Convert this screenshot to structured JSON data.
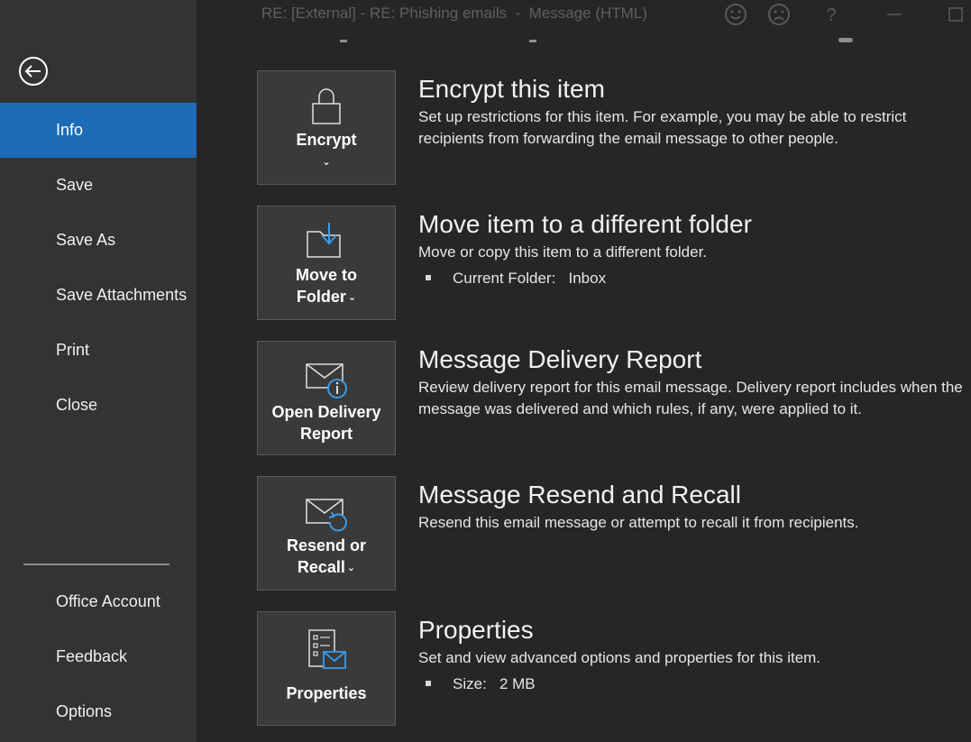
{
  "titlebar": {
    "title": "RE: [External] - RE: Phishing emails  -  Message (HTML)"
  },
  "sidebar": {
    "items": [
      {
        "label": "Info",
        "active": true
      },
      {
        "label": "Save"
      },
      {
        "label": "Save As"
      },
      {
        "label": "Save Attachments"
      },
      {
        "label": "Print"
      },
      {
        "label": "Close"
      }
    ],
    "bottom_items": [
      {
        "label": "Office Account"
      },
      {
        "label": "Feedback"
      },
      {
        "label": "Options"
      }
    ]
  },
  "actions": [
    {
      "button_label": "Encrypt",
      "title": "Encrypt this item",
      "description": "Set up restrictions for this item. For example, you may be able to restrict recipients from forwarding the email message to other people."
    },
    {
      "button_label_line1": "Move to",
      "button_label_line2": "Folder",
      "title": "Move item to a different folder",
      "description": "Move or copy this item to a different folder.",
      "bullet_label": "Current Folder:",
      "bullet_value": "Inbox"
    },
    {
      "button_label_line1": "Open Delivery",
      "button_label_line2": "Report",
      "title": "Message Delivery Report",
      "description": "Review delivery report for this email message. Delivery report includes when the message was delivered and which rules, if any, were applied to it."
    },
    {
      "button_label_line1": "Resend or",
      "button_label_line2": "Recall",
      "title": "Message Resend and Recall",
      "description": "Resend this email message or attempt to recall it from recipients."
    },
    {
      "button_label": "Properties",
      "title": "Properties",
      "description": "Set and view advanced options and properties for this item.",
      "bullet_label": "Size:",
      "bullet_value": "2 MB"
    }
  ],
  "colors": {
    "sidebar_bg": "#333333",
    "main_bg": "#262626",
    "accent": "#1e6bb8",
    "icon_blue": "#3a9be8"
  },
  "icons": [
    "back-arrow-icon",
    "smiley-icon",
    "frown-icon",
    "help-icon",
    "minimize-icon",
    "maximize-icon",
    "lock-icon",
    "folder-arrow-icon",
    "envelope-info-icon",
    "envelope-recall-icon",
    "properties-envelope-icon"
  ]
}
